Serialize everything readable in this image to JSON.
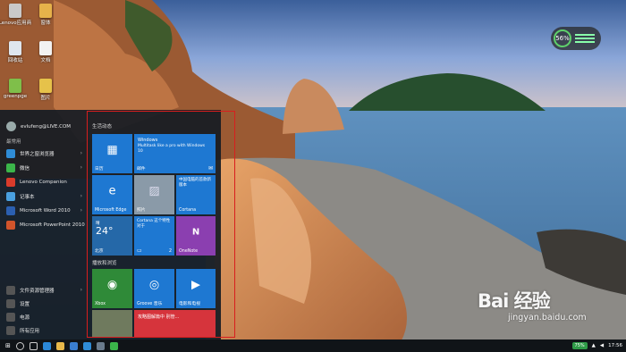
{
  "desktop": {
    "icons": [
      {
        "label": "Lenovo应用商",
        "color": "#c9c9c9",
        "icon": "app-icon"
      },
      {
        "label": "窗体",
        "color": "#e6b24a",
        "icon": "folder-icon"
      },
      {
        "label": "回收站",
        "color": "#dfe6ee",
        "icon": "recycle-bin-icon"
      },
      {
        "label": "文档",
        "color": "#f2f2f2",
        "icon": "document-icon"
      },
      {
        "label": "greenpge",
        "color": "#7fbf4a",
        "icon": "app-icon"
      },
      {
        "label": "图片",
        "color": "#e6c24a",
        "icon": "folder-icon"
      }
    ],
    "widget_percent": "56%"
  },
  "start_menu": {
    "user": "evlufeng@LIVE.COM",
    "section_label": "最常用",
    "apps": [
      {
        "label": "世界之窗浏览器",
        "color": "#2f8cd6"
      },
      {
        "label": "微信",
        "color": "#3bb54a"
      },
      {
        "label": "Lenovo Companion",
        "color": "#d93b2b"
      },
      {
        "label": "记事本",
        "color": "#4aa0e0"
      },
      {
        "label": "Microsoft Word 2010",
        "color": "#2b5fb0"
      },
      {
        "label": "Microsoft PowerPoint 2010",
        "color": "#d1542b"
      }
    ],
    "bottom": [
      {
        "label": "文件资源管理器",
        "icon": "folder-icon"
      },
      {
        "label": "设置",
        "icon": "gear-icon"
      },
      {
        "label": "电源",
        "icon": "power-icon"
      },
      {
        "label": "所有应用",
        "icon": "list-icon"
      }
    ],
    "group1_title": "生活动态",
    "group2_title": "播放和浏览",
    "tiles": {
      "calendar": "日历",
      "mail_title": "Windows",
      "mail_body": "Multitask like a pro with Windows 10",
      "mail_label": "邮件",
      "edge": "Microsoft Edge",
      "photos": "照片",
      "cortana_text": "中国电脑的首款新版本",
      "cortana": "Cortana",
      "weather_temp": "24°",
      "weather_city": "北京",
      "weather_label": "晴",
      "feed_text": "Cortana 这个特性 对于",
      "feed_badge": "2",
      "onenote": "OneNote",
      "xbox": "Xbox",
      "groove": "Groove 音乐",
      "movies": "电影和电视",
      "news_headline": "攻略图解篇中 别管..."
    }
  },
  "taskbar": {
    "start_glyph": "⊞",
    "battery": "75%",
    "time": "17:56"
  },
  "watermark": {
    "brand": "Bai 经验",
    "url": "jingyan.baidu.com"
  }
}
